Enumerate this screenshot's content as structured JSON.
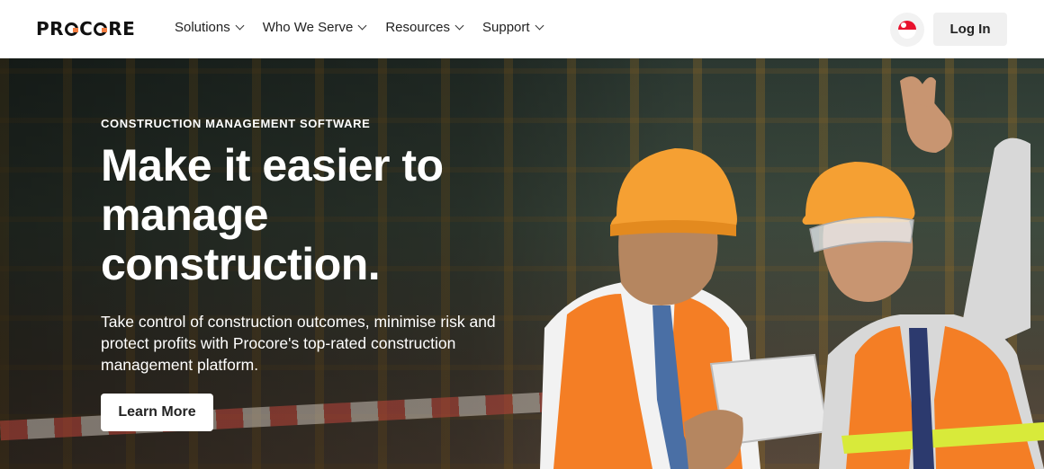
{
  "nav": {
    "logo_text": "PROCORE",
    "menu": [
      {
        "label": "Solutions"
      },
      {
        "label": "Who We Serve"
      },
      {
        "label": "Resources"
      },
      {
        "label": "Support"
      }
    ],
    "region_icon": "singapore-flag-icon",
    "login_label": "Log In"
  },
  "hero": {
    "eyebrow": "CONSTRUCTION MANAGEMENT SOFTWARE",
    "headline": "Make it easier to manage construction.",
    "subtext": "Take control of construction outcomes, minimise risk and protect profits with Procore's top-rated construction management platform.",
    "cta_label": "Learn More"
  },
  "colors": {
    "brand_orange": "#f47e42",
    "text_dark": "#222222",
    "button_light": "#f0f0f0"
  }
}
